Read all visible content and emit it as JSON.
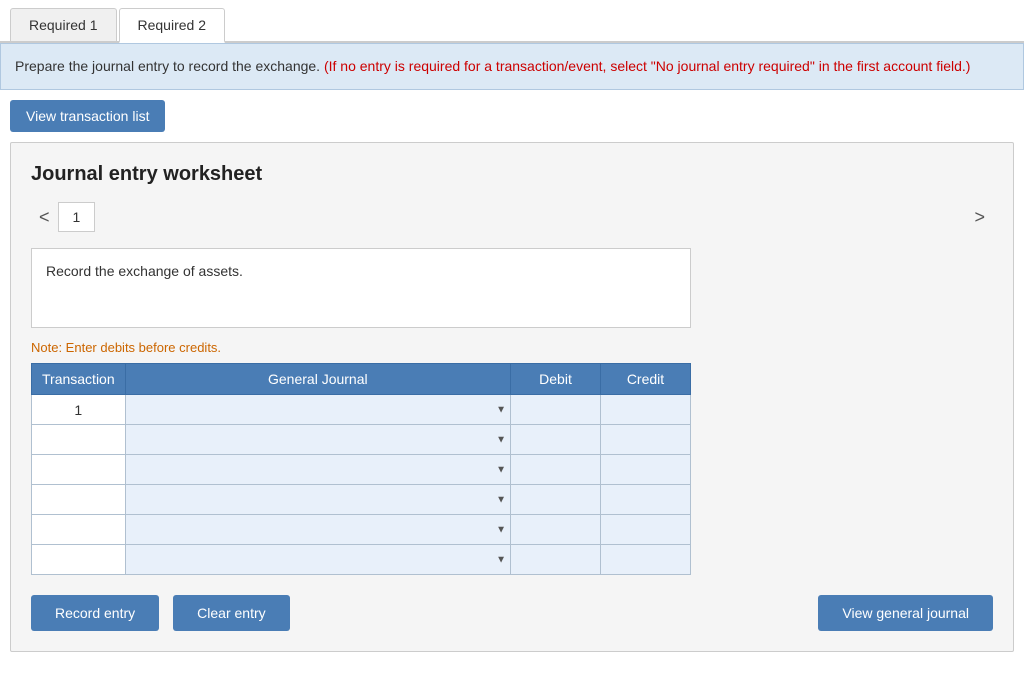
{
  "tabs": [
    {
      "id": "required1",
      "label": "Required 1",
      "active": false
    },
    {
      "id": "required2",
      "label": "Required 2",
      "active": true
    }
  ],
  "info_bar": {
    "main_text": "Prepare the journal entry to record the exchange.",
    "red_text": "(If no entry is required for a transaction/event, select \"No journal entry required\" in the first account field.)"
  },
  "view_transaction_btn": "View transaction list",
  "worksheet": {
    "title": "Journal entry worksheet",
    "current_page": "1",
    "nav_left": "<",
    "nav_right": ">",
    "description": "Record the exchange of assets.",
    "note": "Note: Enter debits before credits.",
    "table": {
      "headers": [
        "Transaction",
        "General Journal",
        "Debit",
        "Credit"
      ],
      "rows": [
        {
          "transaction": "1",
          "gj": "",
          "debit": "",
          "credit": "",
          "dotted": true
        },
        {
          "transaction": "",
          "gj": "",
          "debit": "",
          "credit": "",
          "dotted": false
        },
        {
          "transaction": "",
          "gj": "",
          "debit": "",
          "credit": "",
          "dotted": false
        },
        {
          "transaction": "",
          "gj": "",
          "debit": "",
          "credit": "",
          "dotted": false
        },
        {
          "transaction": "",
          "gj": "",
          "debit": "",
          "credit": "",
          "dotted": false
        },
        {
          "transaction": "",
          "gj": "",
          "debit": "",
          "credit": "",
          "dotted": false
        }
      ]
    }
  },
  "buttons": {
    "record_entry": "Record entry",
    "clear_entry": "Clear entry",
    "view_general_journal": "View general journal"
  }
}
